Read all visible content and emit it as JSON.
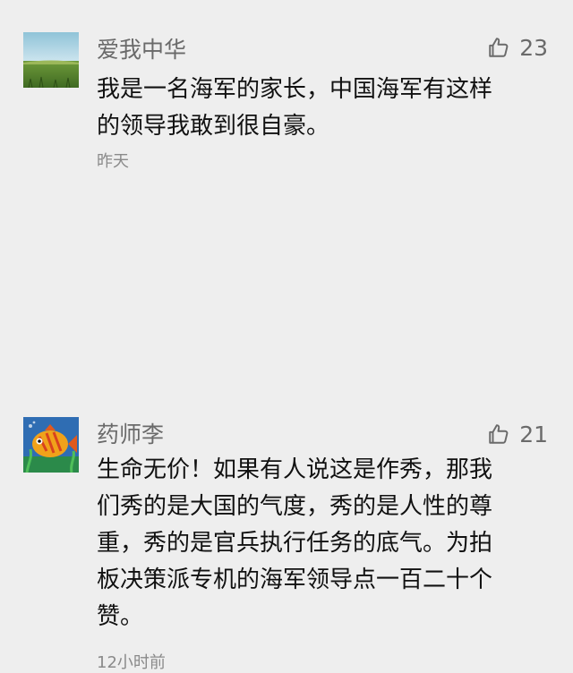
{
  "comments": [
    {
      "username": "爱我中华",
      "likes": "23",
      "content": "我是一名海军的家长，中国海军有这样\n的领导我敢到很自豪。",
      "time": "昨天",
      "avatar_icon": "landscape-icon"
    },
    {
      "username": "药师李",
      "likes": "21",
      "content": "生命无价！如果有人说这是作秀，那我\n们秀的是大国的气度，秀的是人性的尊\n重，秀的是官兵执行任务的底气。为拍\n板决策派专机的海军领导点一百二十个\n赞。",
      "time": "12小时前",
      "avatar_icon": "fish-icon"
    }
  ],
  "like_icon": "thumbs-up-icon"
}
